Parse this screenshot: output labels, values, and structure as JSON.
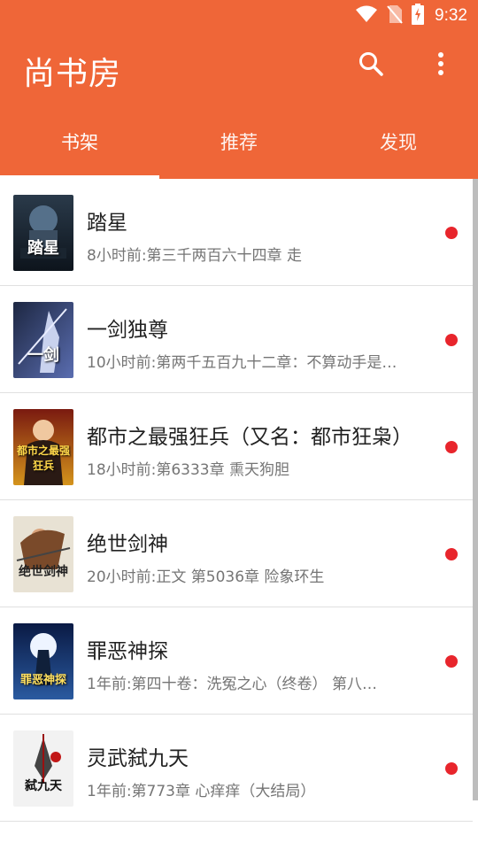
{
  "status": {
    "time": "9:32"
  },
  "appbar": {
    "title": "尚书房"
  },
  "tabs": [
    {
      "label": "书架",
      "active": true
    },
    {
      "label": "推荐",
      "active": false
    },
    {
      "label": "发现",
      "active": false
    }
  ],
  "books": [
    {
      "title": "踏星",
      "update": "8小时前:第三千两百六十四章  走",
      "cover_text": "踏星"
    },
    {
      "title": "一剑独尊",
      "update": "10小时前:第两千五百九十二章：不算动手是…",
      "cover_text": "一剑"
    },
    {
      "title": "都市之最强狂兵（又名：都市狂枭）",
      "update": "18小时前:第6333章 熏天狗胆",
      "cover_text": "都市之最强狂兵"
    },
    {
      "title": "绝世剑神",
      "update": "20小时前:正文 第5036章 险象环生",
      "cover_text": "绝世剑神"
    },
    {
      "title": "罪恶神探",
      "update": "1年前:第四十卷：洗冤之心（终卷） 第八…",
      "cover_text": "罪恶神探"
    },
    {
      "title": "灵武弑九天",
      "update": "1年前:第773章 心痒痒（大结局）",
      "cover_text": "弑九天"
    }
  ]
}
